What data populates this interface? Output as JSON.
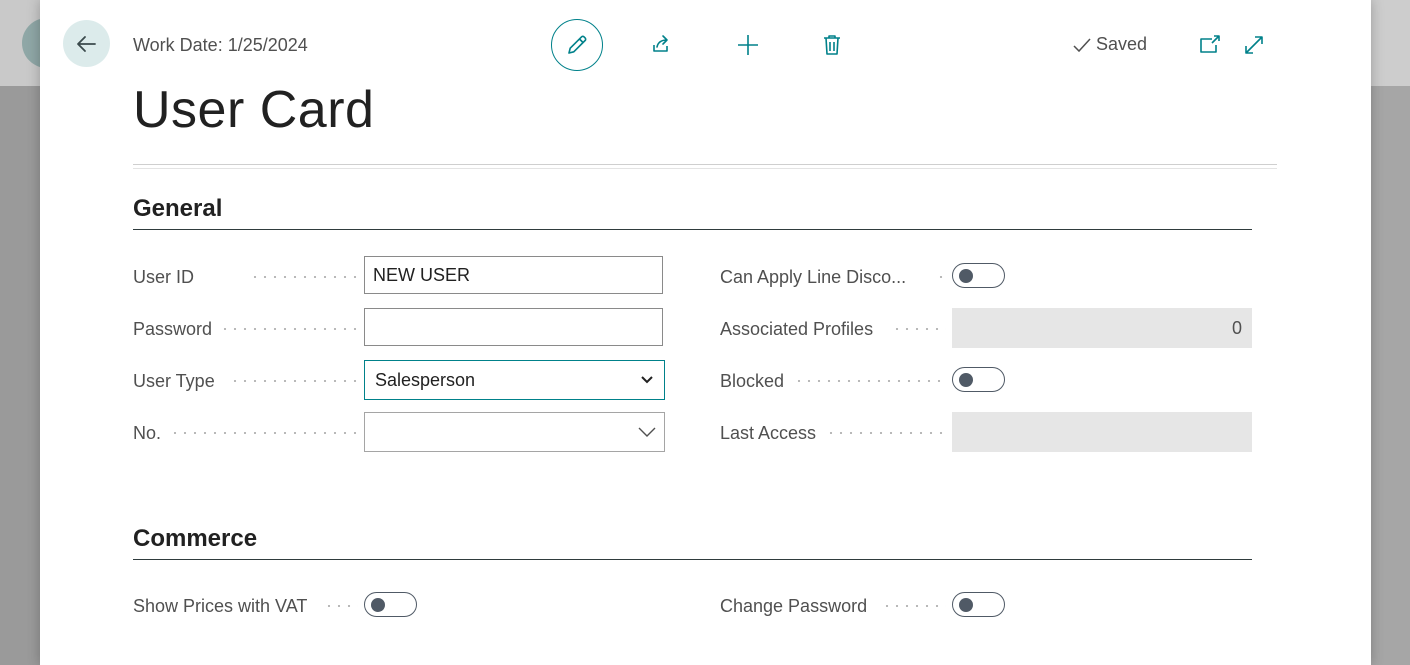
{
  "header": {
    "work_date": "Work Date: 1/25/2024",
    "saved_label": "Saved",
    "icons": {
      "back": "arrow-left-icon",
      "edit": "pencil-icon",
      "share": "share-icon",
      "new": "plus-icon",
      "delete": "trash-icon",
      "saved": "checkmark-icon",
      "open_new_window": "open-new-window-icon",
      "expand": "expand-icon"
    }
  },
  "page": {
    "title": "User Card"
  },
  "general": {
    "title": "General",
    "user_id": {
      "label": "User ID",
      "value": "NEW USER"
    },
    "password": {
      "label": "Password",
      "value": ""
    },
    "user_type": {
      "label": "User Type",
      "value": "Salesperson"
    },
    "no": {
      "label": "No.",
      "value": ""
    },
    "can_apply_line_discount": {
      "label": "Can Apply Line Disco...",
      "on": false
    },
    "associated_profiles": {
      "label": "Associated Profiles",
      "value": "0"
    },
    "blocked": {
      "label": "Blocked",
      "on": false
    },
    "last_access": {
      "label": "Last Access",
      "value": ""
    }
  },
  "commerce": {
    "title": "Commerce",
    "show_prices_with_vat": {
      "label": "Show Prices with VAT",
      "on": false
    },
    "change_password": {
      "label": "Change Password",
      "on": false
    }
  },
  "colors": {
    "accent": "#00818a",
    "toggle": "#505a66",
    "readonly_bg": "#e6e6e6"
  }
}
